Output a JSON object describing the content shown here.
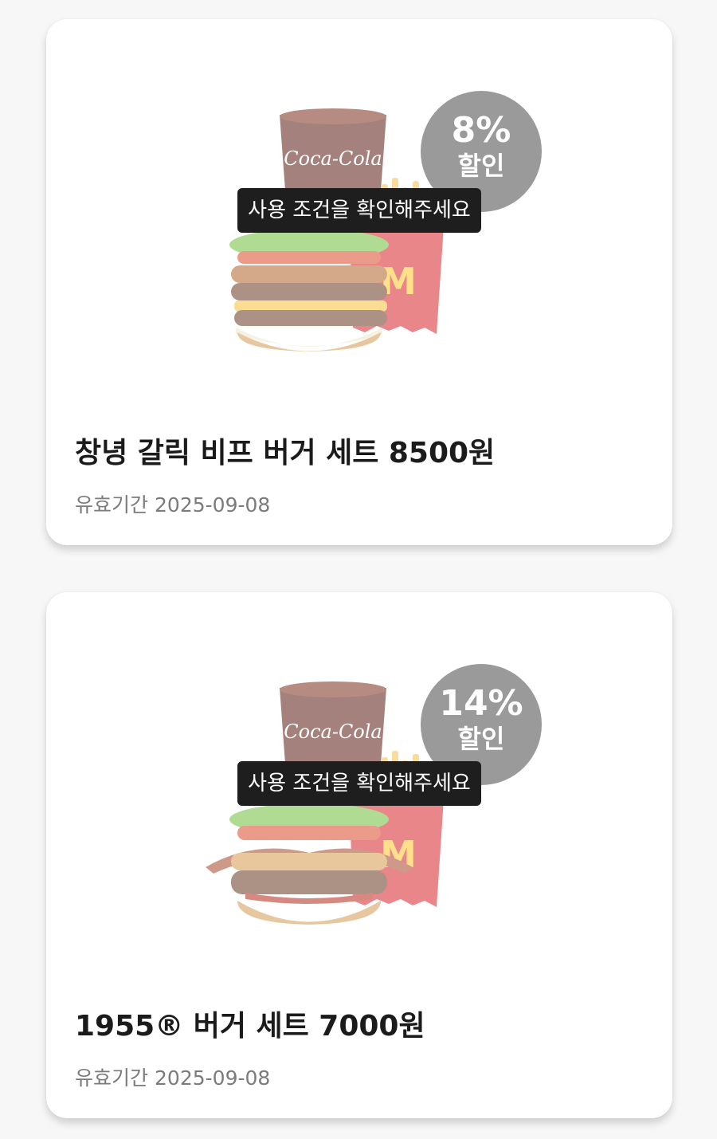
{
  "coupons": [
    {
      "discount_percent": "8%",
      "discount_label": "할인",
      "condition_notice": "사용 조건을 확인해주세요",
      "title": "창녕 갈릭 비프 버거 세트 8500원",
      "expiry_label": "유효기간",
      "expiry_date": "2025-09-08",
      "image": "burger-set-illustration",
      "drink_logo": "Coca-Cola"
    },
    {
      "discount_percent": "14%",
      "discount_label": "할인",
      "condition_notice": "사용 조건을 확인해주세요",
      "title": "1955® 버거 세트 7000원",
      "expiry_label": "유효기간",
      "expiry_date": "2025-09-08",
      "image": "burger-set-illustration",
      "drink_logo": "Coca-Cola"
    }
  ],
  "colors": {
    "badge": "#9a9a9a",
    "tooltip": "#1e1e1e",
    "fries_box": "#d8242c",
    "arches": "#ffc72c"
  }
}
